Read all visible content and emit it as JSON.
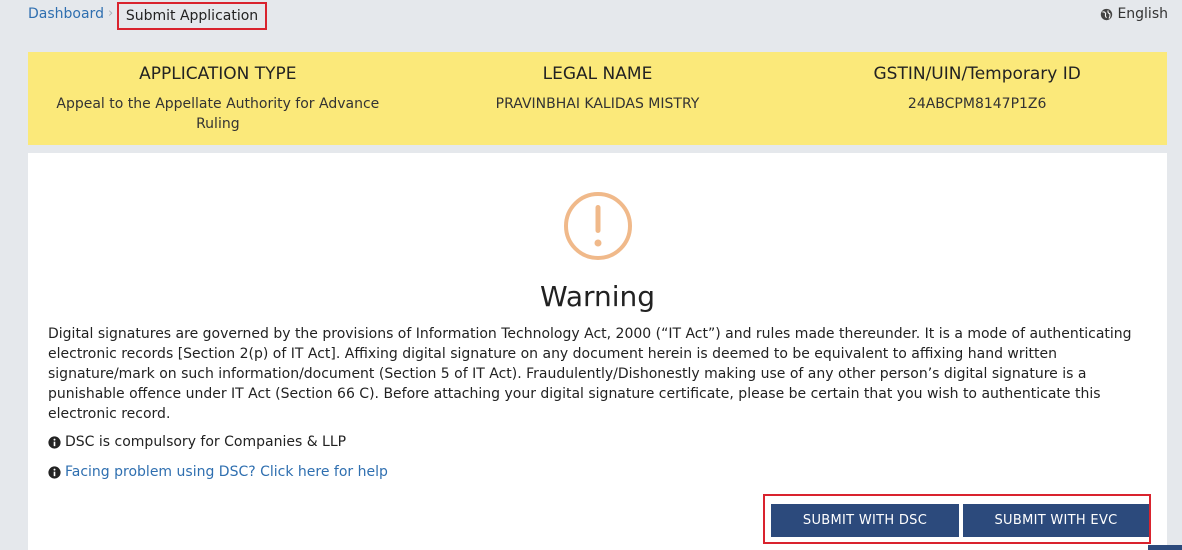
{
  "breadcrumb": {
    "home": "Dashboard",
    "separator": "›",
    "current": "Submit Application"
  },
  "language": {
    "label": "English",
    "icon": "globe-icon"
  },
  "banner": {
    "background": "#fbe97a",
    "application_type": {
      "header": "APPLICATION TYPE",
      "value": "Appeal to the Appellate Authority for Advance Ruling"
    },
    "legal_name": {
      "header": "LEGAL NAME",
      "value": "PRAVINBHAI KALIDAS MISTRY"
    },
    "gstin": {
      "header": "GSTIN/UIN/Temporary ID",
      "value": "24ABCPM8147P1Z6"
    }
  },
  "warning": {
    "icon": "exclamation-circle-icon",
    "icon_color": "#f0b98a",
    "title": "Warning",
    "text": "Digital signatures are governed by the provisions of Information Technology Act, 2000 (“IT Act”) and rules made thereunder. It is a mode of authenticating electronic records [Section 2(p) of IT Act]. Affixing digital signature on any document herein is deemed to be equivalent to affixing hand written signature/mark on such information/document (Section 5 of IT Act). Fraudulently/Dishonestly making use of any other person’s digital signature is a punishable offence under IT Act (Section 66 C). Before attaching your digital signature certificate, please be certain that you wish to authenticate this electronic record.",
    "note_dsc": "DSC is compulsory for Companies & LLP",
    "help_link": "Facing problem using DSC? Click here for help"
  },
  "actions": {
    "submit_dsc": "SUBMIT WITH DSC",
    "submit_evc": "SUBMIT WITH EVC",
    "button_color": "#2c4a7c",
    "highlight_color": "#d9232e"
  }
}
